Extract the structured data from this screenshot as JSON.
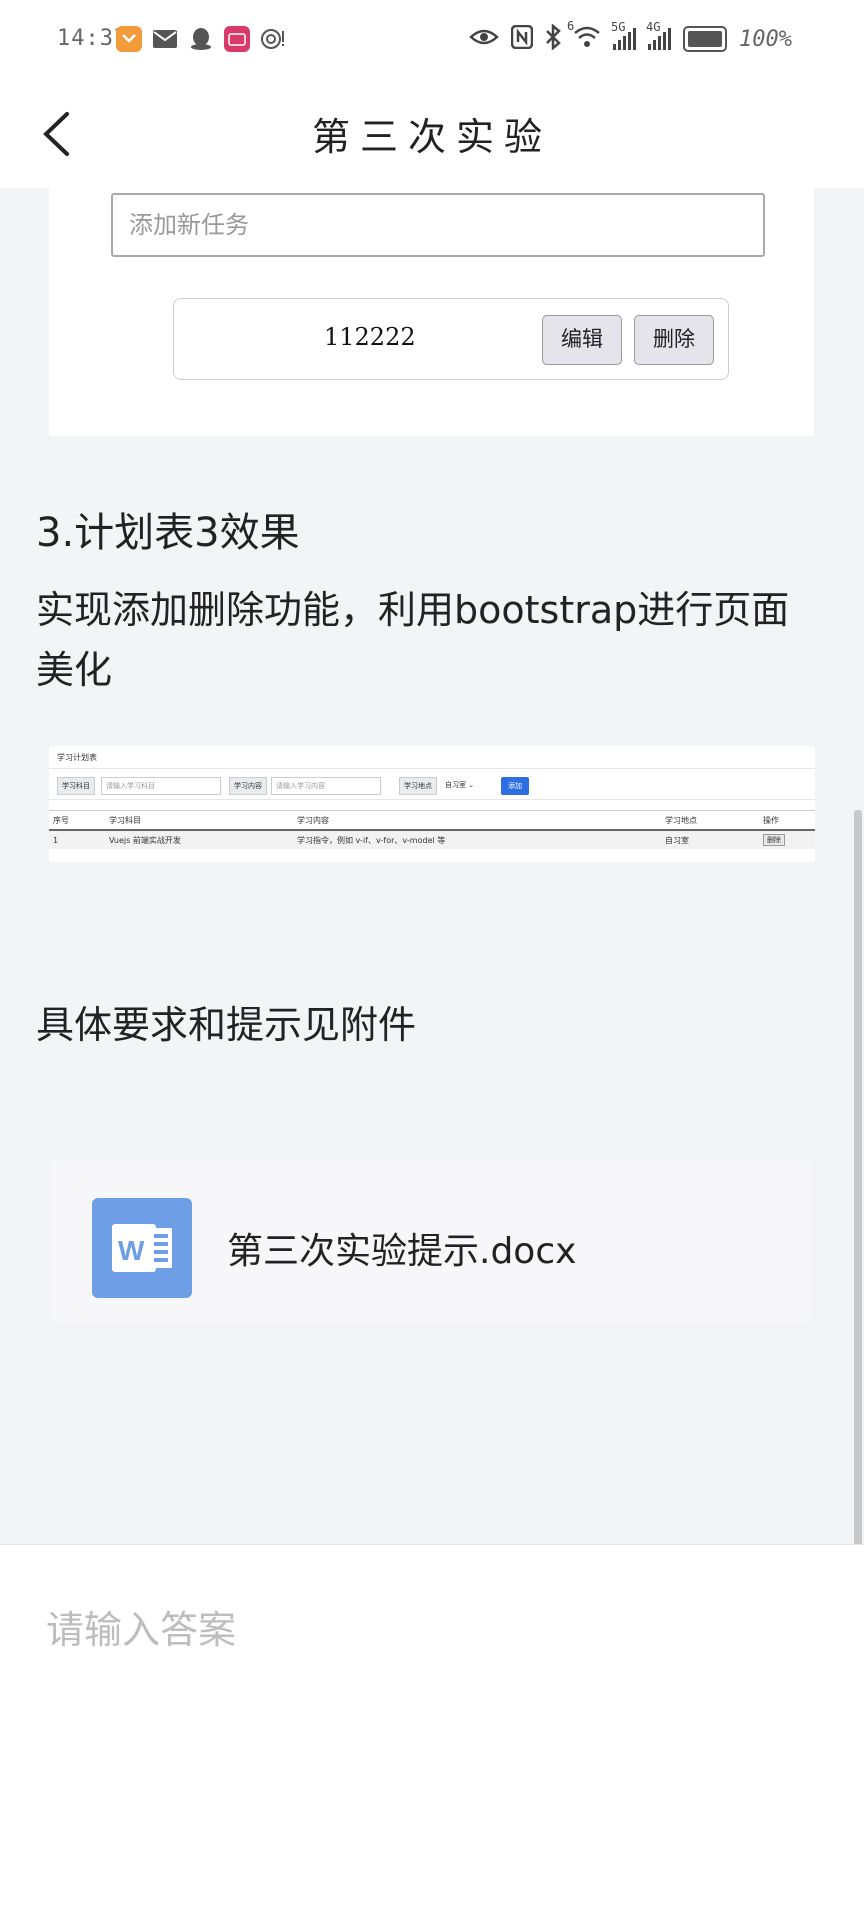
{
  "status_bar": {
    "time": "14:37",
    "battery": "100%",
    "signal_5g": "5G",
    "signal_4g": "4G",
    "signal_6": "6"
  },
  "header": {
    "title": "第三次实验",
    "back_icon": "chevron-left-icon"
  },
  "demo1": {
    "input_placeholder": "添加新任务",
    "task_text": "112222",
    "edit_label": "编辑",
    "delete_label": "删除"
  },
  "section": {
    "heading": "3.计划表3效果",
    "description": "实现添加删除功能，利用bootstrap进行页面美化"
  },
  "demo2": {
    "title": "学习计划表",
    "subject_label": "学习科目",
    "subject_placeholder": "请输入学习科目",
    "content_label": "学习内容",
    "content_placeholder": "请输入学习内容",
    "location_label": "学习地点",
    "location_value": "自习室",
    "add_label": "添加",
    "columns": [
      "序号",
      "学习科目",
      "学习内容",
      "学习地点",
      "操作"
    ],
    "rows": [
      [
        "1",
        "Vuejs 前端实战开发",
        "学习指令，例如 v-if、v-for、v-model 等",
        "自习室",
        "删除"
      ]
    ]
  },
  "requirement_text": "具体要求和提示见附件",
  "attachment": {
    "filename": "第三次实验提示.docx",
    "icon": "word-doc-icon",
    "icon_color": "#6d9ee6"
  },
  "answer": {
    "placeholder": "请输入答案"
  }
}
